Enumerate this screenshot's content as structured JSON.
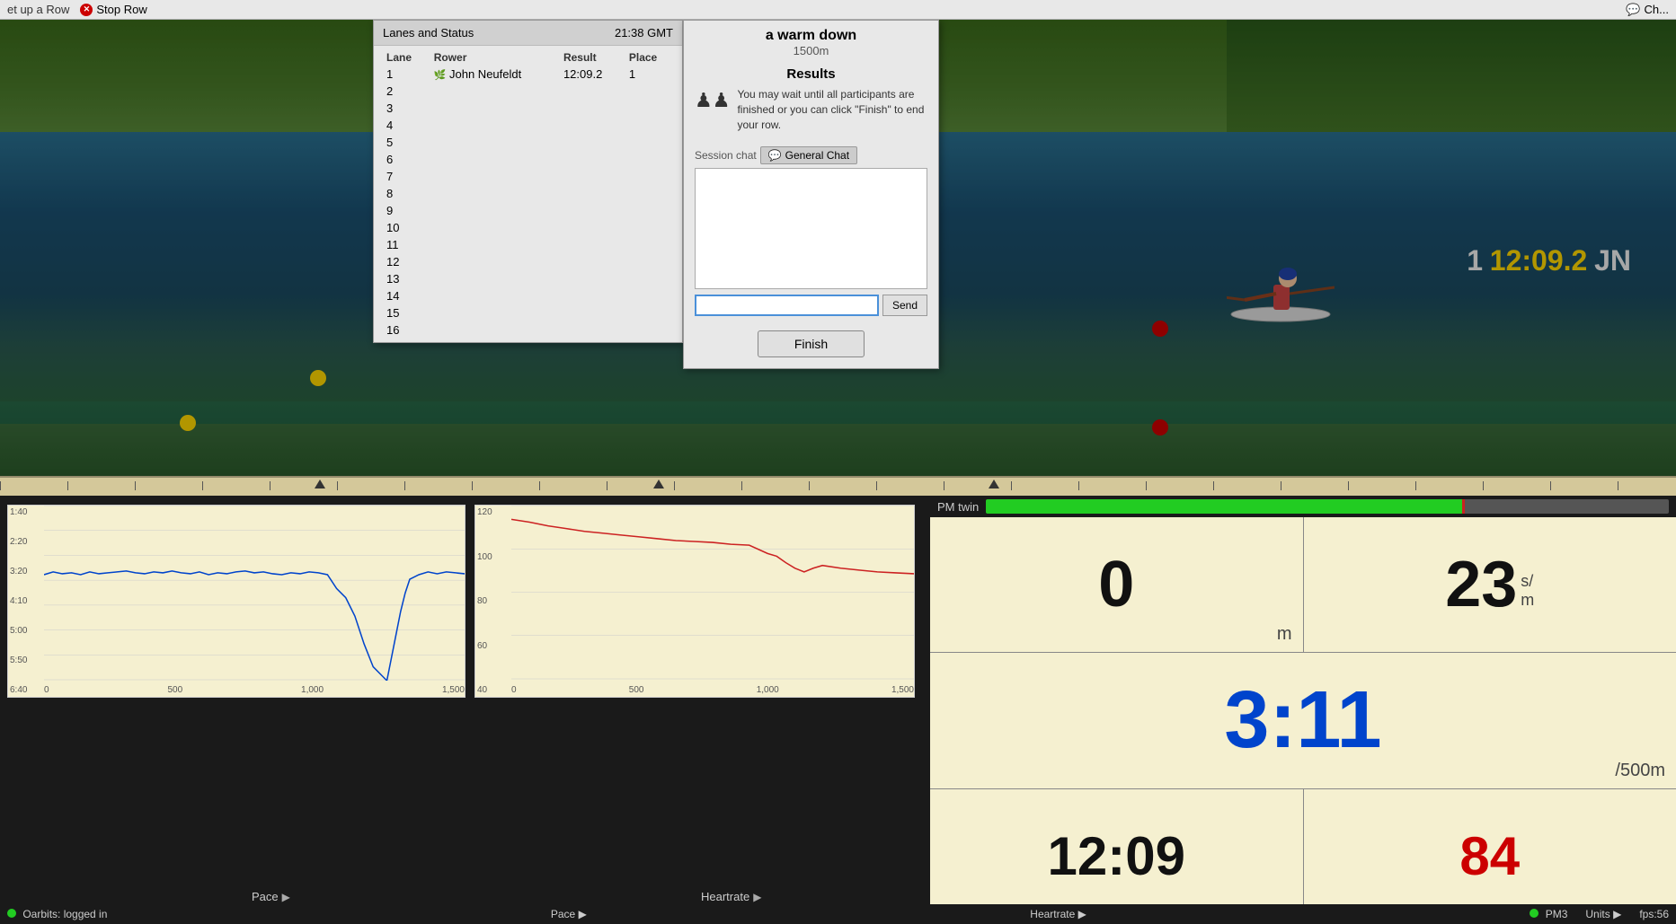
{
  "topbar": {
    "setup_row": "et up a Row",
    "stop_row": "Stop Row",
    "chat_link": "Ch..."
  },
  "lanes_dialog": {
    "title": "Lanes and Status",
    "time": "21:38 GMT",
    "columns": [
      "Lane",
      "Rower",
      "Result",
      "Place"
    ],
    "rows": [
      {
        "lane": "1",
        "rower": "John Neufeldt",
        "result": "12:09.2",
        "place": "1",
        "has_icon": true
      },
      {
        "lane": "2",
        "rower": "",
        "result": "",
        "place": ""
      },
      {
        "lane": "3",
        "rower": "",
        "result": "",
        "place": ""
      },
      {
        "lane": "4",
        "rower": "",
        "result": "",
        "place": ""
      },
      {
        "lane": "5",
        "rower": "",
        "result": "",
        "place": ""
      },
      {
        "lane": "6",
        "rower": "",
        "result": "",
        "place": ""
      },
      {
        "lane": "7",
        "rower": "",
        "result": "",
        "place": ""
      },
      {
        "lane": "8",
        "rower": "",
        "result": "",
        "place": ""
      },
      {
        "lane": "9",
        "rower": "",
        "result": "",
        "place": ""
      },
      {
        "lane": "10",
        "rower": "",
        "result": "",
        "place": ""
      },
      {
        "lane": "11",
        "rower": "",
        "result": "",
        "place": ""
      },
      {
        "lane": "12",
        "rower": "",
        "result": "",
        "place": ""
      },
      {
        "lane": "13",
        "rower": "",
        "result": "",
        "place": ""
      },
      {
        "lane": "14",
        "rower": "",
        "result": "",
        "place": ""
      },
      {
        "lane": "15",
        "rower": "",
        "result": "",
        "place": ""
      },
      {
        "lane": "16",
        "rower": "",
        "result": "",
        "place": ""
      }
    ]
  },
  "results_dialog": {
    "race_name": "a warm down",
    "race_dist": "1500m",
    "results_title": "Results",
    "results_message": "You may wait until all participants are finished or you can click \"Finish\" to end your row.",
    "chat_label": "Session chat",
    "general_chat_btn": "General Chat",
    "chat_icon": "💬",
    "send_btn": "Send",
    "finish_btn": "Finish"
  },
  "race_overlay": {
    "lane": "1",
    "time": "12:09.2",
    "initials": "JN"
  },
  "pm_panel": {
    "title": "PM twin",
    "distance": "0",
    "distance_unit": "m",
    "stroke_rate": "23",
    "stroke_unit": "s/\nm",
    "pace": "3:11",
    "pace_unit": "/500m",
    "elapsed": "12:09",
    "heart_rate": "84"
  },
  "chart_panel": {
    "pace_label": "Pace",
    "heartrate_label": "Heartrate",
    "pace_y_labels": [
      "1:40",
      "2:20",
      "3:20",
      "4:10",
      "5:00",
      "5:50",
      "6:40"
    ],
    "heartrate_y_labels": [
      "120",
      "100",
      "80",
      "60",
      "40"
    ],
    "x_labels_left": [
      "0",
      "500",
      "1,000",
      "1,500"
    ],
    "x_labels_right": [
      "0",
      "500",
      "1,000",
      "1,500"
    ]
  },
  "status_bar": {
    "oarbits_status": "Oarbits: logged in",
    "pace_label": "Pace",
    "heartrate_label": "Heartrate",
    "pm3_label": "PM3",
    "units_label": "Units",
    "fps_label": "fps:56"
  }
}
